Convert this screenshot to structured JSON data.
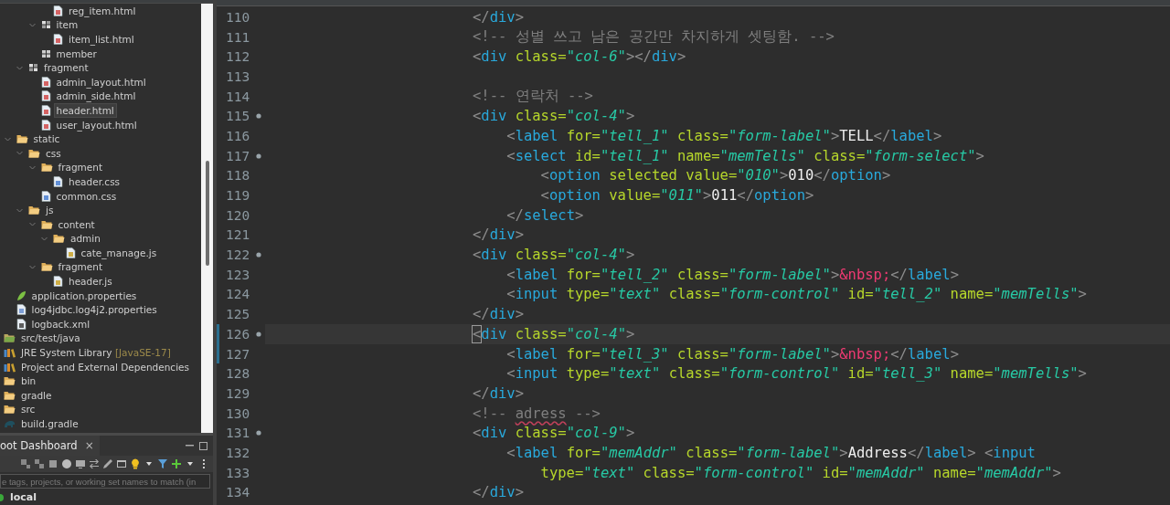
{
  "explorer": {
    "tree": [
      {
        "children": [
          {
            "children": [
              {
                "children": [
                  {
                    "children": [
                      {
                        "label": "reg_item.html",
                        "kind": "html",
                        "selected": false
                      }
                    ]
                  },
                  {
                    "label": "item",
                    "kind": "package",
                    "expanded": true,
                    "selected": false,
                    "children": [
                      {
                        "label": "item_list.html",
                        "kind": "html",
                        "selected": false
                      }
                    ]
                  },
                  {
                    "label": "member",
                    "kind": "empty-package",
                    "selected": false
                  }
                ]
              },
              {
                "label": "fragment",
                "kind": "package",
                "expanded": true,
                "selected": false,
                "children": [
                  {
                    "label": "admin_layout.html",
                    "kind": "html",
                    "selected": false
                  },
                  {
                    "label": "admin_side.html",
                    "kind": "html",
                    "selected": false
                  },
                  {
                    "label": "header.html",
                    "kind": "html",
                    "selected": true
                  },
                  {
                    "label": "user_layout.html",
                    "kind": "html",
                    "selected": false
                  }
                ]
              }
            ]
          },
          {
            "label": "static",
            "kind": "folder",
            "expanded": true,
            "selected": false,
            "children": [
              {
                "label": "css",
                "kind": "folder",
                "expanded": true,
                "selected": false,
                "children": [
                  {
                    "label": "fragment",
                    "kind": "folder",
                    "expanded": true,
                    "selected": false,
                    "children": [
                      {
                        "label": "header.css",
                        "kind": "css",
                        "selected": false
                      }
                    ]
                  },
                  {
                    "label": "common.css",
                    "kind": "css",
                    "selected": false
                  }
                ]
              },
              {
                "label": "js",
                "kind": "folder",
                "expanded": true,
                "selected": false,
                "children": [
                  {
                    "label": "content",
                    "kind": "folder",
                    "expanded": true,
                    "selected": false,
                    "children": [
                      {
                        "label": "admin",
                        "kind": "folder",
                        "expanded": true,
                        "selected": false,
                        "children": [
                          {
                            "label": "cate_manage.js",
                            "kind": "js",
                            "selected": false
                          }
                        ]
                      }
                    ]
                  },
                  {
                    "label": "fragment",
                    "kind": "folder",
                    "expanded": true,
                    "selected": false,
                    "children": [
                      {
                        "label": "header.js",
                        "kind": "js",
                        "selected": false
                      }
                    ]
                  }
                ]
              }
            ]
          },
          {
            "label": "application.properties",
            "kind": "spring",
            "selected": false
          },
          {
            "label": "log4jdbc.log4j2.properties",
            "kind": "text",
            "selected": false
          },
          {
            "label": "logback.xml",
            "kind": "xml",
            "selected": false
          }
        ]
      },
      {
        "label": "src/test/java",
        "kind": "source-folder",
        "selected": false
      },
      {
        "label": "JRE System Library",
        "decoration": "[JavaSE-17]",
        "kind": "library",
        "selected": false
      },
      {
        "label": "Project and External Dependencies",
        "kind": "library",
        "selected": false
      },
      {
        "label": "bin",
        "kind": "folder",
        "selected": false
      },
      {
        "label": "gradle",
        "kind": "folder",
        "selected": false
      },
      {
        "label": "src",
        "kind": "folder",
        "selected": false
      },
      {
        "label": "build.gradle",
        "kind": "gradle",
        "selected": false
      }
    ]
  },
  "dashboard": {
    "title": "oot Dashboard",
    "close": "×",
    "filter": {
      "placeholder": "e tags, projects, or working set names to match (in"
    },
    "targets": [
      {
        "label": "local"
      }
    ]
  },
  "editor": {
    "lines": [
      {
        "number": "110",
        "fold": false,
        "current": false,
        "modified": false,
        "tokens": [
          {
            "kind": "punct",
            "text": "                        </"
          },
          {
            "kind": "tag",
            "text": "div"
          },
          {
            "kind": "punct",
            "text": ">"
          }
        ]
      },
      {
        "number": "111",
        "fold": false,
        "current": false,
        "modified": false,
        "tokens": [
          {
            "kind": "comment",
            "text": "                        <!-- 성별 쓰고 남은 공간만 차지하게 셋팅함. -->"
          }
        ]
      },
      {
        "number": "112",
        "fold": false,
        "current": false,
        "modified": false,
        "tokens": [
          {
            "kind": "punct",
            "text": "                        <"
          },
          {
            "kind": "tag",
            "text": "div"
          },
          {
            "kind": "attr",
            "text": " class="
          },
          {
            "kind": "string",
            "text": "\"col-6\""
          },
          {
            "kind": "punct",
            "text": "></"
          },
          {
            "kind": "tag",
            "text": "div"
          },
          {
            "kind": "punct",
            "text": ">"
          }
        ]
      },
      {
        "number": "113",
        "fold": false,
        "current": false,
        "modified": false
      },
      {
        "number": "114",
        "fold": false,
        "current": false,
        "modified": false,
        "tokens": [
          {
            "kind": "comment",
            "text": "                        <!-- 연락처 -->"
          }
        ]
      },
      {
        "number": "115",
        "fold": true,
        "current": false,
        "modified": false,
        "tokens": [
          {
            "kind": "punct",
            "text": "                        <"
          },
          {
            "kind": "tag",
            "text": "div"
          },
          {
            "kind": "attr",
            "text": " class="
          },
          {
            "kind": "string",
            "text": "\"col-4\""
          },
          {
            "kind": "punct",
            "text": ">"
          }
        ]
      },
      {
        "number": "116",
        "fold": false,
        "current": false,
        "modified": false,
        "tokens": [
          {
            "kind": "punct",
            "text": "                            <"
          },
          {
            "kind": "tag",
            "text": "label"
          },
          {
            "kind": "attr",
            "text": " for="
          },
          {
            "kind": "string",
            "text": "\"tell_1\""
          },
          {
            "kind": "attr",
            "text": " class="
          },
          {
            "kind": "string",
            "text": "\"form-label\""
          },
          {
            "kind": "punct",
            "text": ">"
          },
          {
            "kind": "text",
            "text": "TELL"
          },
          {
            "kind": "punct",
            "text": "</"
          },
          {
            "kind": "tag",
            "text": "label"
          },
          {
            "kind": "punct",
            "text": ">"
          }
        ]
      },
      {
        "number": "117",
        "fold": true,
        "current": false,
        "modified": false,
        "tokens": [
          {
            "kind": "punct",
            "text": "                            <"
          },
          {
            "kind": "tag",
            "text": "select"
          },
          {
            "kind": "attr",
            "text": " id="
          },
          {
            "kind": "string",
            "text": "\"tell_1\""
          },
          {
            "kind": "attr",
            "text": " name="
          },
          {
            "kind": "string",
            "text": "\"memTells\""
          },
          {
            "kind": "attr",
            "text": " class="
          },
          {
            "kind": "string",
            "text": "\"form-select\""
          },
          {
            "kind": "punct",
            "text": ">"
          }
        ]
      },
      {
        "number": "118",
        "fold": false,
        "current": false,
        "modified": false,
        "tokens": [
          {
            "kind": "punct",
            "text": "                                <"
          },
          {
            "kind": "tag",
            "text": "option"
          },
          {
            "kind": "attr",
            "text": " selected value="
          },
          {
            "kind": "string",
            "text": "\"010\""
          },
          {
            "kind": "punct",
            "text": ">"
          },
          {
            "kind": "text",
            "text": "010"
          },
          {
            "kind": "punct",
            "text": "</"
          },
          {
            "kind": "tag",
            "text": "option"
          },
          {
            "kind": "punct",
            "text": ">"
          }
        ]
      },
      {
        "number": "119",
        "fold": false,
        "current": false,
        "modified": false,
        "tokens": [
          {
            "kind": "punct",
            "text": "                                <"
          },
          {
            "kind": "tag",
            "text": "option"
          },
          {
            "kind": "attr",
            "text": " value="
          },
          {
            "kind": "string",
            "text": "\"011\""
          },
          {
            "kind": "punct",
            "text": ">"
          },
          {
            "kind": "text",
            "text": "011"
          },
          {
            "kind": "punct",
            "text": "</"
          },
          {
            "kind": "tag",
            "text": "option"
          },
          {
            "kind": "punct",
            "text": ">"
          }
        ]
      },
      {
        "number": "120",
        "fold": false,
        "current": false,
        "modified": false,
        "tokens": [
          {
            "kind": "punct",
            "text": "                            </"
          },
          {
            "kind": "tag",
            "text": "select"
          },
          {
            "kind": "punct",
            "text": ">"
          }
        ]
      },
      {
        "number": "121",
        "fold": false,
        "current": false,
        "modified": false,
        "tokens": [
          {
            "kind": "punct",
            "text": "                        </"
          },
          {
            "kind": "tag",
            "text": "div"
          },
          {
            "kind": "punct",
            "text": ">"
          }
        ]
      },
      {
        "number": "122",
        "fold": true,
        "current": false,
        "modified": false,
        "tokens": [
          {
            "kind": "punct",
            "text": "                        <"
          },
          {
            "kind": "tag",
            "text": "div"
          },
          {
            "kind": "attr",
            "text": " class="
          },
          {
            "kind": "string",
            "text": "\"col-4\""
          },
          {
            "kind": "punct",
            "text": ">"
          }
        ]
      },
      {
        "number": "123",
        "fold": false,
        "current": false,
        "modified": false,
        "tokens": [
          {
            "kind": "punct",
            "text": "                            <"
          },
          {
            "kind": "tag",
            "text": "label"
          },
          {
            "kind": "attr",
            "text": " for="
          },
          {
            "kind": "string",
            "text": "\"tell_2\""
          },
          {
            "kind": "attr",
            "text": " class="
          },
          {
            "kind": "string",
            "text": "\"form-label\""
          },
          {
            "kind": "punct",
            "text": ">"
          },
          {
            "kind": "entity",
            "text": "&nbsp;"
          },
          {
            "kind": "punct",
            "text": "</"
          },
          {
            "kind": "tag",
            "text": "label"
          },
          {
            "kind": "punct",
            "text": ">"
          }
        ]
      },
      {
        "number": "124",
        "fold": false,
        "current": false,
        "modified": false,
        "tokens": [
          {
            "kind": "punct",
            "text": "                            <"
          },
          {
            "kind": "tag",
            "text": "input"
          },
          {
            "kind": "attr",
            "text": " type="
          },
          {
            "kind": "string",
            "text": "\"text\""
          },
          {
            "kind": "attr",
            "text": " class="
          },
          {
            "kind": "string",
            "text": "\"form-control\""
          },
          {
            "kind": "attr",
            "text": " id="
          },
          {
            "kind": "string",
            "text": "\"tell_2\""
          },
          {
            "kind": "attr",
            "text": " name="
          },
          {
            "kind": "string",
            "text": "\"memTells\""
          },
          {
            "kind": "punct",
            "text": ">"
          }
        ]
      },
      {
        "number": "125",
        "fold": false,
        "current": false,
        "modified": false,
        "tokens": [
          {
            "kind": "punct",
            "text": "                        </"
          },
          {
            "kind": "tag",
            "text": "div"
          },
          {
            "kind": "punct",
            "text": ">"
          }
        ]
      },
      {
        "number": "126",
        "fold": true,
        "current": true,
        "modified": true,
        "tokens": [
          {
            "kind": "cursor",
            "text": "                        <"
          },
          {
            "kind": "tag",
            "text": "div"
          },
          {
            "kind": "attr",
            "text": " class="
          },
          {
            "kind": "string",
            "text": "\"col-4\""
          },
          {
            "kind": "punct",
            "text": ">"
          }
        ]
      },
      {
        "number": "127",
        "fold": false,
        "current": false,
        "modified": true,
        "tokens": [
          {
            "kind": "punct",
            "text": "                            <"
          },
          {
            "kind": "tag",
            "text": "label"
          },
          {
            "kind": "attr",
            "text": " for="
          },
          {
            "kind": "string",
            "text": "\"tell_3\""
          },
          {
            "kind": "attr",
            "text": " class="
          },
          {
            "kind": "string",
            "text": "\"form-label\""
          },
          {
            "kind": "punct",
            "text": ">"
          },
          {
            "kind": "entity",
            "text": "&nbsp;"
          },
          {
            "kind": "punct",
            "text": "</"
          },
          {
            "kind": "tag",
            "text": "label"
          },
          {
            "kind": "punct",
            "text": ">"
          }
        ]
      },
      {
        "number": "128",
        "fold": false,
        "current": false,
        "modified": false,
        "tokens": [
          {
            "kind": "punct",
            "text": "                            <"
          },
          {
            "kind": "tag",
            "text": "input"
          },
          {
            "kind": "attr",
            "text": " type="
          },
          {
            "kind": "string",
            "text": "\"text\""
          },
          {
            "kind": "attr",
            "text": " class="
          },
          {
            "kind": "string",
            "text": "\"form-control\""
          },
          {
            "kind": "attr",
            "text": " id="
          },
          {
            "kind": "string",
            "text": "\"tell_3\""
          },
          {
            "kind": "attr",
            "text": " name="
          },
          {
            "kind": "string",
            "text": "\"memTells\""
          },
          {
            "kind": "punct",
            "text": ">"
          }
        ]
      },
      {
        "number": "129",
        "fold": false,
        "current": false,
        "modified": false,
        "tokens": [
          {
            "kind": "punct",
            "text": "                        </"
          },
          {
            "kind": "tag",
            "text": "div"
          },
          {
            "kind": "punct",
            "text": ">"
          }
        ]
      },
      {
        "number": "130",
        "fold": false,
        "current": false,
        "modified": false,
        "tokens": [
          {
            "kind": "comment",
            "text": "                        <!-- "
          },
          {
            "kind": "misspelled",
            "text": "adress"
          },
          {
            "kind": "comment",
            "text": " -->"
          }
        ]
      },
      {
        "number": "131",
        "fold": true,
        "current": false,
        "modified": false,
        "tokens": [
          {
            "kind": "punct",
            "text": "                        <"
          },
          {
            "kind": "tag",
            "text": "div"
          },
          {
            "kind": "attr",
            "text": " class="
          },
          {
            "kind": "string",
            "text": "\"col-9\""
          },
          {
            "kind": "punct",
            "text": ">"
          }
        ]
      },
      {
        "number": "132",
        "fold": false,
        "current": false,
        "modified": false,
        "tokens": [
          {
            "kind": "punct",
            "text": "                            <"
          },
          {
            "kind": "tag",
            "text": "label"
          },
          {
            "kind": "attr",
            "text": " for="
          },
          {
            "kind": "string",
            "text": "\"memAddr\""
          },
          {
            "kind": "attr",
            "text": " class="
          },
          {
            "kind": "string",
            "text": "\"form-label\""
          },
          {
            "kind": "punct",
            "text": ">"
          },
          {
            "kind": "text",
            "text": "Address"
          },
          {
            "kind": "punct",
            "text": "</"
          },
          {
            "kind": "tag",
            "text": "label"
          },
          {
            "kind": "punct",
            "text": "> <"
          },
          {
            "kind": "tag",
            "text": "input"
          }
        ]
      },
      {
        "number": "133",
        "fold": false,
        "current": false,
        "modified": false,
        "tokens": [
          {
            "kind": "attr",
            "text": "                                type="
          },
          {
            "kind": "string",
            "text": "\"text\""
          },
          {
            "kind": "attr",
            "text": " class="
          },
          {
            "kind": "string",
            "text": "\"form-control\""
          },
          {
            "kind": "attr",
            "text": " id="
          },
          {
            "kind": "string",
            "text": "\"memAddr\""
          },
          {
            "kind": "attr",
            "text": " name="
          },
          {
            "kind": "string",
            "text": "\"memAddr\""
          },
          {
            "kind": "punct",
            "text": ">"
          }
        ]
      },
      {
        "number": "134",
        "fold": false,
        "current": false,
        "modified": false,
        "tokens": [
          {
            "kind": "punct",
            "text": "                        </"
          },
          {
            "kind": "tag",
            "text": "div"
          },
          {
            "kind": "punct",
            "text": ">"
          }
        ]
      }
    ]
  }
}
